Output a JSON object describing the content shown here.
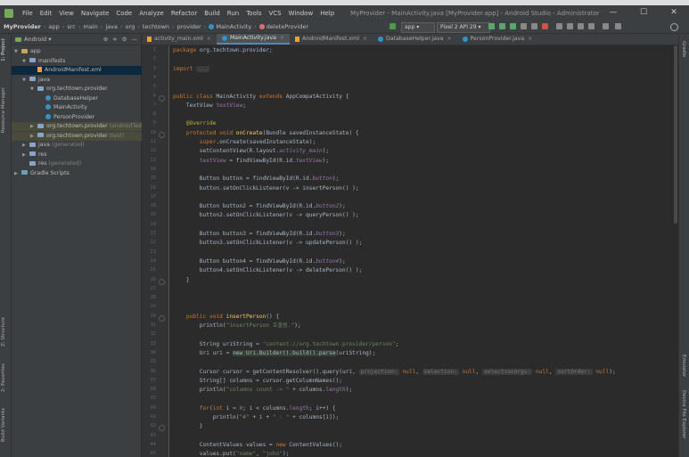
{
  "title_bar": {
    "menu": [
      "File",
      "Edit",
      "View",
      "Navigate",
      "Code",
      "Analyze",
      "Refactor",
      "Build",
      "Run",
      "Tools",
      "VCS",
      "Window",
      "Help"
    ],
    "window_title": "MyProvider - MainActivity.java [MyProvider.app] - Android Studio - Administrator",
    "controls": [
      "—",
      "☐",
      "✕"
    ]
  },
  "nav": {
    "breadcrumb": [
      "MyProvider",
      "app",
      "src",
      "main",
      "java",
      "org",
      "techtown",
      "provider",
      "MainActivity",
      "deleteProvider"
    ],
    "run_config": "app",
    "device": "Pixel 2 API 29"
  },
  "left_tabs": [
    "1: Project",
    "Resource Manager",
    "Z: Structure",
    "2: Favorites",
    "Build Variants"
  ],
  "right_tabs": [
    "Gradle",
    "Emulator",
    "Device File Explorer"
  ],
  "project": {
    "view": "Android",
    "tree": [
      {
        "label": "app",
        "extra": "",
        "icon": "folder",
        "tri": "▼",
        "indent": 0
      },
      {
        "label": "manifests",
        "extra": "",
        "icon": "folder",
        "tri": "▼",
        "indent": 1
      },
      {
        "label": "AndroidManifest.xml",
        "extra": "",
        "icon": "xml",
        "tri": "",
        "indent": 2,
        "sel": true
      },
      {
        "label": "java",
        "extra": "",
        "icon": "folder",
        "tri": "▼",
        "indent": 1
      },
      {
        "label": "org.techtown.provider",
        "extra": "",
        "icon": "folder",
        "tri": "▼",
        "indent": 2
      },
      {
        "label": "DatabaseHelper",
        "extra": "",
        "icon": "class",
        "tri": "",
        "indent": 3
      },
      {
        "label": "MainActivity",
        "extra": "",
        "icon": "class",
        "tri": "",
        "indent": 3
      },
      {
        "label": "PersonProvider",
        "extra": "",
        "icon": "class",
        "tri": "",
        "indent": 3
      },
      {
        "label": "org.techtown.provider",
        "extra": "(androidTest)",
        "icon": "folder",
        "tri": "▶",
        "indent": 2,
        "hl": true
      },
      {
        "label": "org.techtown.provider",
        "extra": "(test)",
        "icon": "folder",
        "tri": "▶",
        "indent": 2,
        "hl": true
      },
      {
        "label": "java",
        "extra": "(generated)",
        "icon": "folder",
        "tri": "▶",
        "indent": 1
      },
      {
        "label": "res",
        "extra": "",
        "icon": "folder",
        "tri": "▶",
        "indent": 1
      },
      {
        "label": "res",
        "extra": "(generated)",
        "icon": "folder",
        "tri": "",
        "indent": 1
      },
      {
        "label": "Gradle Scripts",
        "extra": "",
        "icon": "gradle",
        "tri": "▶",
        "indent": 0
      }
    ]
  },
  "tabs": [
    {
      "label": "activity_main.xml",
      "active": false
    },
    {
      "label": "MainActivity.java",
      "active": true
    },
    {
      "label": "AndroidManifest.xml",
      "active": false
    },
    {
      "label": "DatabaseHelper.java",
      "active": false
    },
    {
      "label": "PersonProvider.java",
      "active": false
    }
  ],
  "editor": {
    "line_numbers": [
      1,
      2,
      3,
      4,
      5,
      6,
      7,
      8,
      9,
      10,
      11,
      12,
      13,
      14,
      15,
      16,
      17,
      18,
      19,
      20,
      21,
      22,
      23,
      24,
      25,
      26,
      27,
      28,
      29,
      30,
      31,
      32,
      33,
      34,
      35,
      36,
      37,
      38,
      39,
      40,
      41,
      42,
      43,
      44,
      45
    ],
    "code": [
      [
        [
          "kw",
          "package "
        ],
        [
          "t",
          "org.techtown.provider;"
        ]
      ],
      [],
      [
        [
          "kw",
          "import "
        ],
        [
          "hint",
          "..."
        ]
      ],
      [],
      [],
      [
        [
          "kw",
          "public class "
        ],
        [
          "t",
          "MainActivity "
        ],
        [
          "kw",
          "extends "
        ],
        [
          "t",
          "AppCompatActivity {"
        ]
      ],
      [
        [
          "t",
          "    TextView "
        ],
        [
          "fld",
          "textView"
        ],
        [
          "t",
          ";"
        ]
      ],
      [],
      [
        [
          "an",
          "    @Override"
        ]
      ],
      [
        [
          "kw",
          "    protected void "
        ],
        [
          "fn",
          "onCreate"
        ],
        [
          "t",
          "(Bundle savedInstanceState) {"
        ]
      ],
      [
        [
          "kw",
          "        super"
        ],
        [
          "t",
          ".onCreate(savedInstanceState);"
        ]
      ],
      [
        [
          "t",
          "        setContentView(R.layout."
        ],
        [
          "itl",
          "activity_main"
        ],
        [
          "t",
          ");"
        ]
      ],
      [
        [
          "fld",
          "        textView "
        ],
        [
          "t",
          "= findViewById(R.id."
        ],
        [
          "itl",
          "textView"
        ],
        [
          "t",
          ");"
        ]
      ],
      [],
      [
        [
          "t",
          "        Button button = findViewById(R.id."
        ],
        [
          "itl",
          "button"
        ],
        [
          "t",
          ");"
        ]
      ],
      [
        [
          "t",
          "        button.setOnClickListener(v -> insertPerson() );"
        ]
      ],
      [],
      [
        [
          "t",
          "        Button button2 = findViewById(R.id."
        ],
        [
          "itl",
          "button2"
        ],
        [
          "t",
          ");"
        ]
      ],
      [
        [
          "t",
          "        button2.setOnClickListener(v -> queryPerson() );"
        ]
      ],
      [],
      [
        [
          "t",
          "        Button button3 = findViewById(R.id."
        ],
        [
          "itl",
          "button3"
        ],
        [
          "t",
          ");"
        ]
      ],
      [
        [
          "t",
          "        button3.setOnClickListener(v -> updatePerson() );"
        ]
      ],
      [],
      [
        [
          "t",
          "        Button button4 = findViewById(R.id."
        ],
        [
          "itl",
          "button4"
        ],
        [
          "t",
          ");"
        ]
      ],
      [
        [
          "t",
          "        button4.setOnClickListener(v -> deletePerson() );"
        ]
      ],
      [
        [
          "t",
          "    }"
        ]
      ],
      [],
      [],
      [],
      [
        [
          "kw",
          "    public void "
        ],
        [
          "fn",
          "insertPerson"
        ],
        [
          "t",
          "() {"
        ]
      ],
      [
        [
          "t",
          "        println("
        ],
        [
          "str",
          "\"insertPerson 호출됨.\""
        ],
        [
          "t",
          ");"
        ]
      ],
      [],
      [
        [
          "t",
          "        String uriString = "
        ],
        [
          "str",
          "\"content://org.techtown.provider/person\""
        ],
        [
          "t",
          ";"
        ]
      ],
      [
        [
          "t",
          "        Uri uri = "
        ],
        [
          "hl",
          "new Uri.Builder().build().parse"
        ],
        [
          "t",
          "(uriString);"
        ]
      ],
      [],
      [
        [
          "t",
          "        Cursor cursor = getContentResolver().query(uri, "
        ],
        [
          "hint",
          "projection:"
        ],
        [
          "kw",
          " null"
        ],
        [
          "t",
          ", "
        ],
        [
          "hint",
          "selection:"
        ],
        [
          "kw",
          " null"
        ],
        [
          "t",
          ", "
        ],
        [
          "hint",
          "selectionArgs:"
        ],
        [
          "kw",
          " null"
        ],
        [
          "t",
          ", "
        ],
        [
          "hint",
          "sortOrder:"
        ],
        [
          "kw",
          " null"
        ],
        [
          "t",
          ");"
        ]
      ],
      [
        [
          "t",
          "        String[] columns = cursor.getColumnNames();"
        ]
      ],
      [
        [
          "t",
          "        println("
        ],
        [
          "str",
          "\"columns count -> \""
        ],
        [
          "t",
          " + columns."
        ],
        [
          "fld",
          "length"
        ],
        [
          "t",
          ");"
        ]
      ],
      [],
      [
        [
          "kw",
          "        for"
        ],
        [
          "t",
          "("
        ],
        [
          "kw",
          "int "
        ],
        [
          "t",
          "i = "
        ],
        [
          "fld",
          "0"
        ],
        [
          "t",
          "; i < columns."
        ],
        [
          "fld",
          "length"
        ],
        [
          "t",
          "; i++) {"
        ]
      ],
      [
        [
          "t",
          "            println("
        ],
        [
          "str",
          "\"#\""
        ],
        [
          "t",
          " + i + "
        ],
        [
          "str",
          "\" : \""
        ],
        [
          "t",
          " + columns[i]);"
        ]
      ],
      [
        [
          "t",
          "        }"
        ]
      ],
      [],
      [
        [
          "t",
          "        ContentValues values = "
        ],
        [
          "kw",
          "new "
        ],
        [
          "t",
          "ContentValues();"
        ]
      ],
      [
        [
          "t",
          "        values.put("
        ],
        [
          "str",
          "\"name\""
        ],
        [
          "t",
          ", "
        ],
        [
          "str",
          "\"john\""
        ],
        [
          "t",
          ");"
        ]
      ]
    ]
  }
}
